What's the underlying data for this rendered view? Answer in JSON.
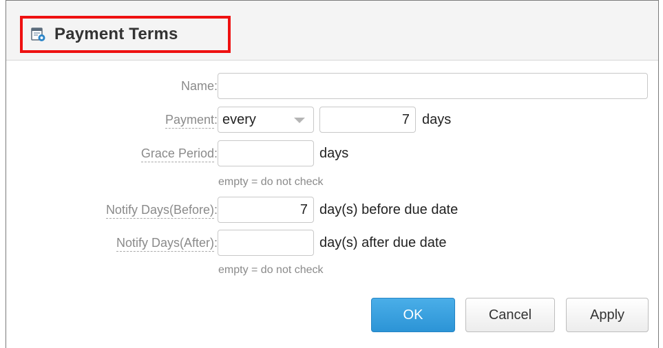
{
  "dialog": {
    "title": "Payment Terms",
    "icon": "calendar-settings-icon"
  },
  "form": {
    "name": {
      "label": "Name",
      "value": "",
      "placeholder": ""
    },
    "payment": {
      "label": "Payment",
      "selected": "every",
      "value": "7",
      "unit": "days"
    },
    "grace_period": {
      "label": "Grace Period",
      "value": "",
      "unit": "days",
      "hint": "empty = do not check"
    },
    "notify_before": {
      "label": "Notify Days(Before)",
      "value": "7",
      "unit": "day(s) before due date"
    },
    "notify_after": {
      "label": "Notify Days(After)",
      "value": "",
      "unit": "day(s) after due date",
      "hint": "empty = do not check"
    }
  },
  "buttons": {
    "ok": "OK",
    "cancel": "Cancel",
    "apply": "Apply"
  },
  "colors": {
    "accent": "#2c94d6",
    "highlight_border": "#ee1111"
  }
}
